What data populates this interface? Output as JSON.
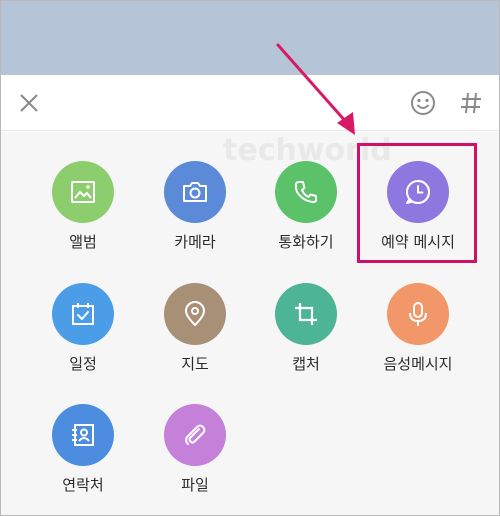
{
  "watermark": "techworld",
  "toolbar": {
    "close_icon": "close-icon",
    "emoji_icon": "smile-icon",
    "hash_icon": "hash-icon"
  },
  "grid": [
    {
      "label": "앨범",
      "icon": "image-icon",
      "color": "#8ccd6d"
    },
    {
      "label": "카메라",
      "icon": "camera-icon",
      "color": "#5b8ad9"
    },
    {
      "label": "통화하기",
      "icon": "phone-icon",
      "color": "#5cc26a"
    },
    {
      "label": "예약 메시지",
      "icon": "clock-icon",
      "color": "#8f77e0"
    },
    {
      "label": "일정",
      "icon": "calendar-icon",
      "color": "#4c9de8"
    },
    {
      "label": "지도",
      "icon": "map-pin-icon",
      "color": "#a89077"
    },
    {
      "label": "캡처",
      "icon": "crop-icon",
      "color": "#4db595"
    },
    {
      "label": "음성메시지",
      "icon": "mic-icon",
      "color": "#f2976a"
    },
    {
      "label": "연락처",
      "icon": "contact-icon",
      "color": "#4c8de0"
    },
    {
      "label": "파일",
      "icon": "paperclip-icon",
      "color": "#c580d9"
    }
  ],
  "annotation": {
    "highlight_color": "#cf1265",
    "arrow_color": "#d81a66"
  }
}
